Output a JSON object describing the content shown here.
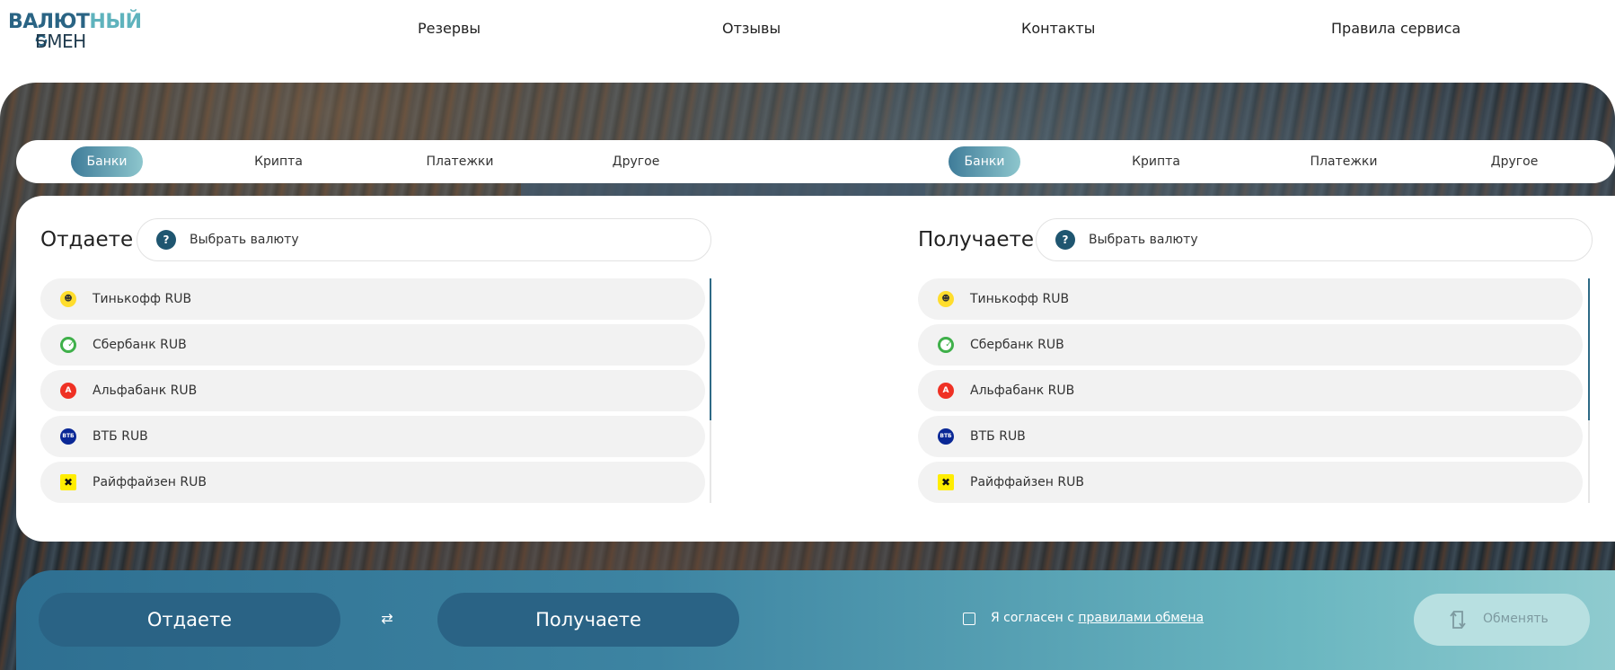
{
  "logo": {
    "line1_part1": "ВАЛЮТ",
    "line1_part2": "НЫЙ",
    "line2": "БМЕН"
  },
  "nav": [
    "Резервы",
    "Отзывы",
    "Контакты",
    "Правила сервиса"
  ],
  "left_tabs": [
    "Банки",
    "Крипта",
    "Платежки",
    "Другое"
  ],
  "right_tabs": [
    "Банки",
    "Крипта",
    "Платежки",
    "Другое"
  ],
  "active_tab": "Банки",
  "give": {
    "title": "Отдаете",
    "select_icon": "?",
    "select_placeholder": "Выбрать валюту",
    "items": [
      {
        "name": "Тинькофф RUB",
        "icon": "tinkoff-icon",
        "glyph": "☻"
      },
      {
        "name": "Сбербанк RUB",
        "icon": "sber-icon",
        "glyph": "✓"
      },
      {
        "name": "Альфабанк RUB",
        "icon": "alfa-icon",
        "glyph": "A"
      },
      {
        "name": "ВТБ RUB",
        "icon": "vtb-icon",
        "glyph": "ВТБ"
      },
      {
        "name": "Райффайзен RUB",
        "icon": "raif-icon",
        "glyph": "✖"
      }
    ]
  },
  "receive": {
    "title": "Получаете",
    "select_icon": "?",
    "select_placeholder": "Выбрать валюту",
    "items": [
      {
        "name": "Тинькофф RUB",
        "icon": "tinkoff-icon",
        "glyph": "☻"
      },
      {
        "name": "Сбербанк RUB",
        "icon": "sber-icon",
        "glyph": "✓"
      },
      {
        "name": "Альфабанк RUB",
        "icon": "alfa-icon",
        "glyph": "A"
      },
      {
        "name": "ВТБ RUB",
        "icon": "vtb-icon",
        "glyph": "ВТБ"
      },
      {
        "name": "Райффайзен RUB",
        "icon": "raif-icon",
        "glyph": "✖"
      }
    ]
  },
  "bottom": {
    "give_label": "Отдаете",
    "receive_label": "Получаете",
    "swap_glyph": "⇄",
    "agree_text": "Я согласен с ",
    "agree_link": "правилами обмена",
    "exchange_label": "Обменять"
  },
  "colors": {
    "accent": "#2a6385",
    "teal": "#8dc6cd",
    "dark": "#1f5670"
  }
}
